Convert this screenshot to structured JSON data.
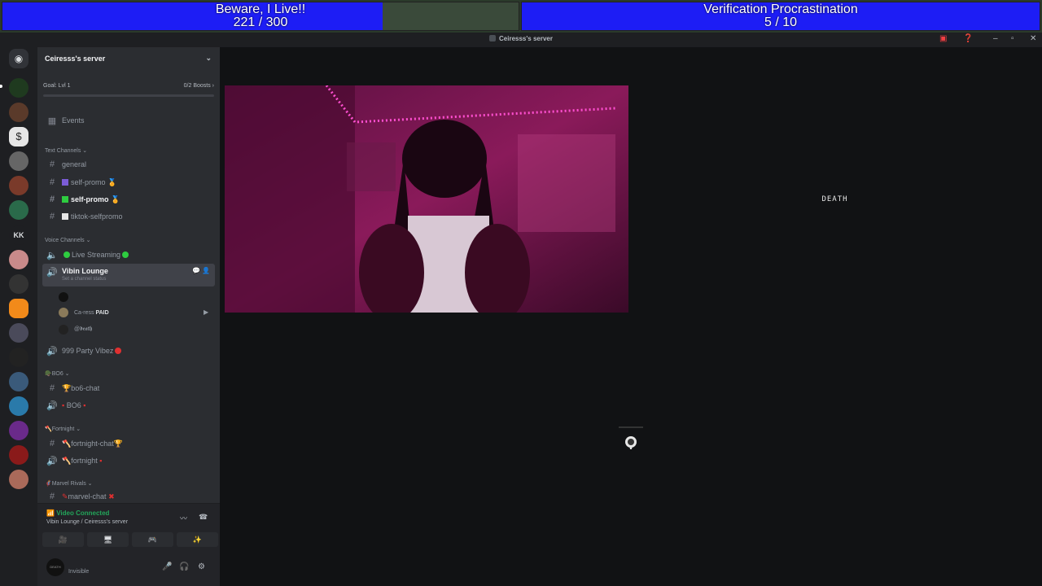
{
  "overlay": {
    "goal1": {
      "title": "Beware, I Live!!",
      "count": "221 / 300",
      "progress": 0.7367
    },
    "goal2": {
      "title": "Verification Procrastination",
      "count": "5 / 10",
      "progress": 1.0
    }
  },
  "titlebar": {
    "title": "Ceiresss's server"
  },
  "server": {
    "name": "Ceiresss's server",
    "goal": "Goal: Lvl 1",
    "boosts": "0/2 Boosts"
  },
  "channels": {
    "events": "Events",
    "text_category": "Text Channels",
    "general": "general",
    "self_promo_1": "self-promo",
    "self_promo_2": "self-promo",
    "tiktok": "tiktok-selfpromo",
    "voice_category": "Voice Channels",
    "live_streaming": "Live Streaming",
    "vibin_lounge": "Vibin Lounge",
    "channel_status": "Set a channel status",
    "voice_users": [
      "",
      "Ca-ress",
      "@𝖉𝖊𝖆𝖙𝖍"
    ],
    "paid_badge": "PAID",
    "party": "999 Party Vibez",
    "bo6_category": "BO6",
    "bo6_chat": "bo6-chat",
    "bo6_voice": "BO6",
    "fortnite_category": "Fortnight",
    "fortnite_chat": "fortnight-chat",
    "fortnite_voice": "fortnight",
    "marvel_category": "Marvel Rivals",
    "marvel_chat": "marvel-chat"
  },
  "rtc": {
    "status": "Video Connected",
    "sub": "Vibin Lounge / Ceiresss's server"
  },
  "user": {
    "name": "",
    "status": "Invisible",
    "avatar_text": "DEATH"
  },
  "rail": {
    "kk": "KK"
  },
  "stage": {
    "death_label": "DEATH"
  },
  "icons": [
    "discord-icon",
    "calendar-icon",
    "hash-icon",
    "speaker-icon",
    "mic-icon",
    "headphones-icon",
    "gear-icon",
    "signal-icon",
    "hangup-icon",
    "camera-icon",
    "screen-share-icon",
    "activity-icon",
    "soundboard-icon",
    "help-icon",
    "inbox-icon",
    "minimize-icon",
    "maximize-icon",
    "close-icon"
  ],
  "colors": {
    "accent_green": "#23a55a",
    "goal_blue": "#1d1df5",
    "background": "#111214"
  }
}
